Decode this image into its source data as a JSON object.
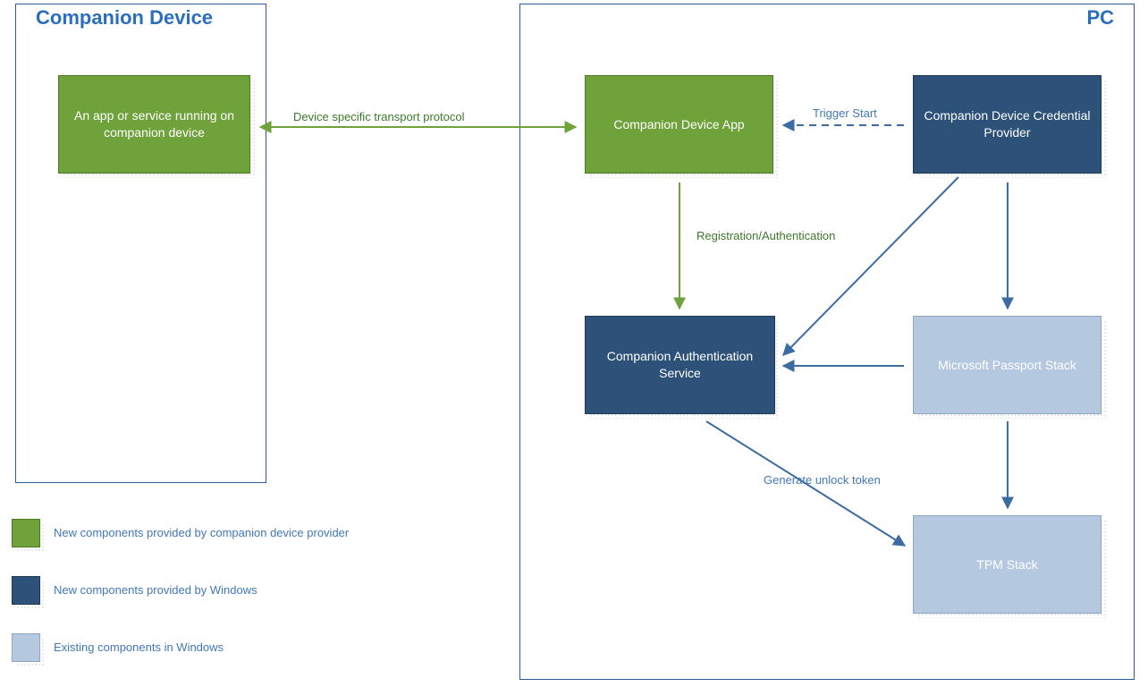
{
  "containers": {
    "companion": {
      "title": "Companion Device"
    },
    "pc": {
      "title": "PC"
    }
  },
  "nodes": {
    "app_service": "An app or service running on companion device",
    "device_app": "Companion Device App",
    "cred_provider": "Companion Device Credential Provider",
    "auth_service": "Companion Authentication Service",
    "passport": "Microsoft Passport Stack",
    "tpm": "TPM Stack"
  },
  "edges": {
    "transport": "Device specific transport protocol",
    "trigger": "Trigger Start",
    "reg_auth": "Registration/Authentication",
    "unlock": "Generate unlock token"
  },
  "legend": {
    "green": "New components provided by companion device provider",
    "darkblue": "New components provided by Windows",
    "lightblue": "Existing components in Windows"
  },
  "colors": {
    "green": "#6fa23a",
    "darkblue": "#2d5178",
    "lightblue": "#b4c8e0",
    "border": "#2a5a9a",
    "label_green": "#3e7a2a",
    "label_blue": "#4178b8"
  }
}
